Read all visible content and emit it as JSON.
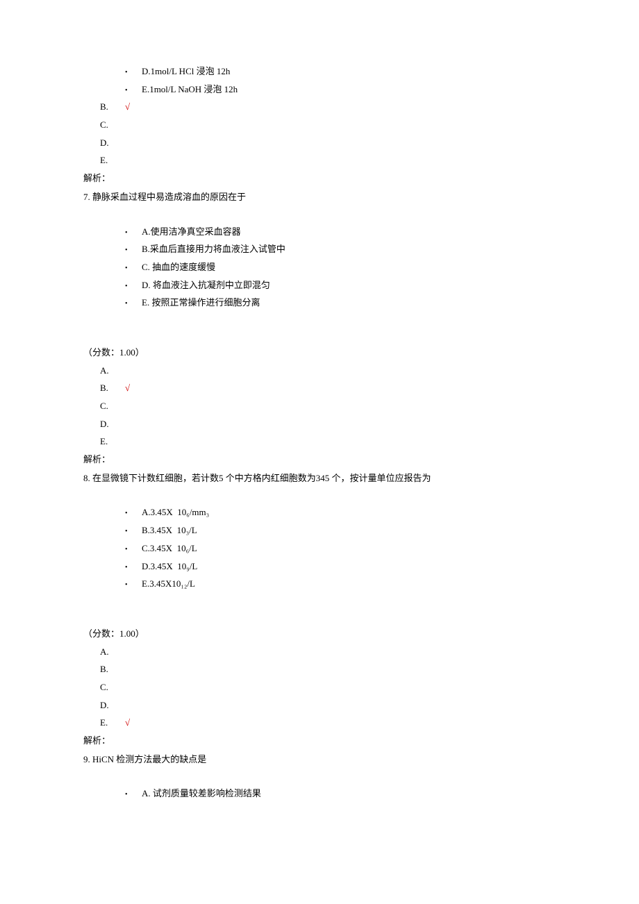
{
  "q6_tail": {
    "options": [
      {
        "label": "D.1mol/L  HCl 浸泡  12h"
      },
      {
        "label": "E.1mol/L  NaOH 浸泡  12h"
      }
    ],
    "answers": [
      {
        "letter": "B.",
        "mark": "√"
      },
      {
        "letter": "C.",
        "mark": ""
      },
      {
        "letter": "D.",
        "mark": ""
      },
      {
        "letter": "E.",
        "mark": ""
      }
    ],
    "explain": "解析："
  },
  "q7": {
    "stem": "7.  静脉采血过程中易造成溶血的原因在于",
    "options": [
      {
        "label": "A.使用洁净真空采血容器"
      },
      {
        "label": "B.采血后直接用力将血液注入试管中"
      },
      {
        "label": "C. 抽血的速度缓慢"
      },
      {
        "label": "D.  将血液注入抗凝剂中立即混匀"
      },
      {
        "label": "E.  按照正常操作进行细胞分离"
      }
    ],
    "score": "（分数：1.00）",
    "answers": [
      {
        "letter": "A.",
        "mark": ""
      },
      {
        "letter": "B.",
        "mark": "√"
      },
      {
        "letter": "C.",
        "mark": ""
      },
      {
        "letter": "D.",
        "mark": ""
      },
      {
        "letter": "E.",
        "mark": ""
      }
    ],
    "explain": "解析："
  },
  "q8": {
    "stem": "8. 在显微镜下计数红细胞，若计数5 个中方格内红细胞数为345 个，按计量单位应报告为",
    "options": [
      {
        "label": "A.3.45X",
        "unit": "10₆/mm₃"
      },
      {
        "label": "B.3.45X",
        "unit": "10₃/L"
      },
      {
        "label": "C.3.45X",
        "unit": "10₆/L"
      },
      {
        "label": "D.3.45X",
        "unit": "10₉/L"
      },
      {
        "label": "E.3.45X10₁₂/L",
        "unit": ""
      }
    ],
    "score": "（分数：1.00）",
    "answers": [
      {
        "letter": "A.",
        "mark": ""
      },
      {
        "letter": "B.",
        "mark": ""
      },
      {
        "letter": "C.",
        "mark": ""
      },
      {
        "letter": "D.",
        "mark": ""
      },
      {
        "letter": "E.",
        "mark": "√"
      }
    ],
    "explain": "解析："
  },
  "q9": {
    "stem": "9. HiCN 检测方法最大的缺点是",
    "options": [
      {
        "label": "A.  试剂质量较差影响检测结果"
      }
    ]
  }
}
